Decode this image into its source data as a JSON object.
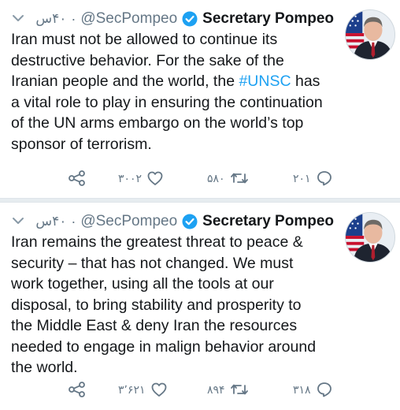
{
  "colors": {
    "accent": "#1da1f2",
    "verified": "#1da1f2",
    "muted": "#657786",
    "text": "#14171a"
  },
  "tweets": [
    {
      "author": {
        "name": "Secretary Pompeo",
        "handle": "@SecPompeo",
        "verified_icon": "verified-badge-icon",
        "avatar_icon": "profile-photo"
      },
      "separator": "·",
      "time": "۴۰س",
      "text_before": "Iran must not be allowed to continue its\ndestructive behavior. For the sake of the\nIranian people and the world, the ",
      "hashtag": "#UNSC",
      "text_after": " has\na vital role to play in ensuring the continuation\nof the UN arms embargo on the world’s top\nsponsor of terrorism.",
      "actions": {
        "replies": "۲۰۱",
        "retweets": "۵۸۰",
        "likes": "۳۰۰۲",
        "share_icon": "share-icon"
      }
    },
    {
      "author": {
        "name": "Secretary Pompeo",
        "handle": "@SecPompeo",
        "verified_icon": "verified-badge-icon",
        "avatar_icon": "profile-photo"
      },
      "separator": "·",
      "time": "۴۰س",
      "text": "Iran remains the greatest threat to peace &\nsecurity – that has not changed. We must\nwork together, using all the tools at our\ndisposal, to bring stability and prosperity to\nthe Middle East & deny Iran the resources\nneeded to engage in malign behavior around\nthe world.",
      "actions": {
        "replies": "۳۱۸",
        "retweets": "۸۹۴",
        "likes": "۳٬۶۲۱",
        "share_icon": "share-icon"
      }
    }
  ]
}
